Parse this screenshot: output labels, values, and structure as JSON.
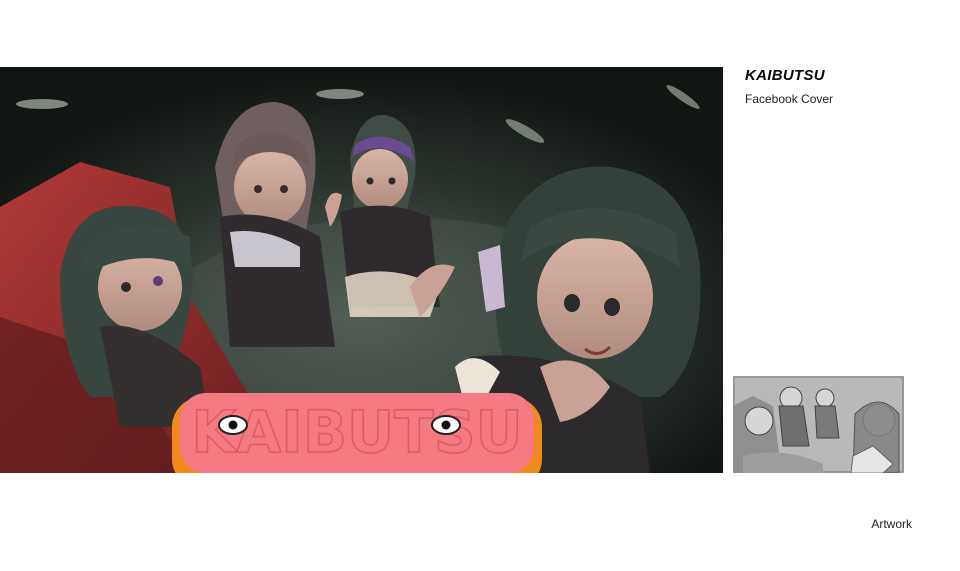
{
  "project": {
    "title": "KAIBUTSU",
    "subtitle": "Facebook Cover"
  },
  "artwork": {
    "logo_text": "KAIBUTSU",
    "logo_fill": "#f47a83",
    "logo_outline": "#f08a1c",
    "background": "#1a211c",
    "couch_color": "#9c2f30",
    "hair_color": "#3d4a42"
  },
  "thumbnail": {
    "icon": "sketch-thumbnail"
  },
  "footer": {
    "link_label": "Artwork"
  }
}
